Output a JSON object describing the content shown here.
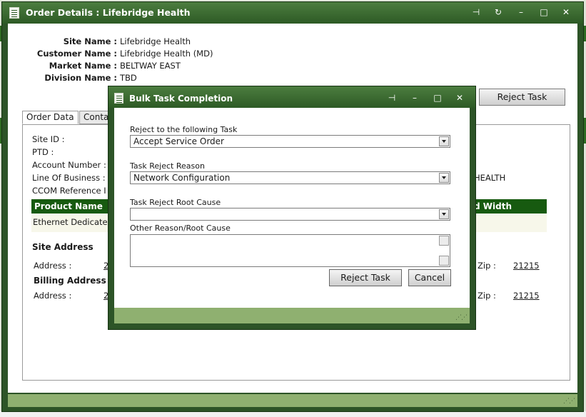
{
  "window": {
    "title": "Order Details : Lifebridge Health",
    "controls": [
      "pin-icon",
      "refresh-icon",
      "minimize-icon",
      "maximize-icon",
      "close-icon"
    ]
  },
  "summary": {
    "site_name_label": "Site Name :",
    "site_name": "Lifebridge Health",
    "customer_name_label": "Customer Name :",
    "customer_name": "Lifebridge Health (MD)",
    "market_name_label": "Market Name :",
    "market_name": "BELTWAY EAST",
    "division_name_label": "Division Name :",
    "division_name": "TBD"
  },
  "reject_task_button": "Reject Task",
  "tabs": [
    "Order Data",
    "Contac"
  ],
  "order_data": {
    "site_id_label": "Site ID :",
    "ptd_label": "PTD :",
    "account_number_label": "Account Number :",
    "line_of_business_label": "Line Of Business :",
    "ccom_reference_label": "CCOM Reference I",
    "line_of_business_value_fragment": "HEALTH",
    "product_header": "Product Name",
    "bandwidth_header_fragment": "d Width",
    "product_value": "Ethernet Dedicated",
    "site_address_heading": "Site Address",
    "site_address_label": "Address :",
    "site_address_fragment": "24",
    "site_zip_label": "Zip :",
    "site_zip": "21215",
    "billing_address_heading": "Billing Address",
    "billing_address_label": "Address :",
    "billing_address_fragment": "24",
    "billing_zip_label": "Zip :",
    "billing_zip": "21215"
  },
  "dialog": {
    "title": "Bulk Task Completion",
    "reject_to_label": "Reject to the following Task",
    "reject_to_value": "Accept Service Order",
    "reason_label": "Task Reject Reason",
    "reason_value": "Network Configuration",
    "root_cause_label": "Task Reject Root Cause",
    "root_cause_value": "",
    "other_label": "Other Reason/Root Cause",
    "other_value": "",
    "reject_button": "Reject Task",
    "cancel_button": "Cancel"
  }
}
